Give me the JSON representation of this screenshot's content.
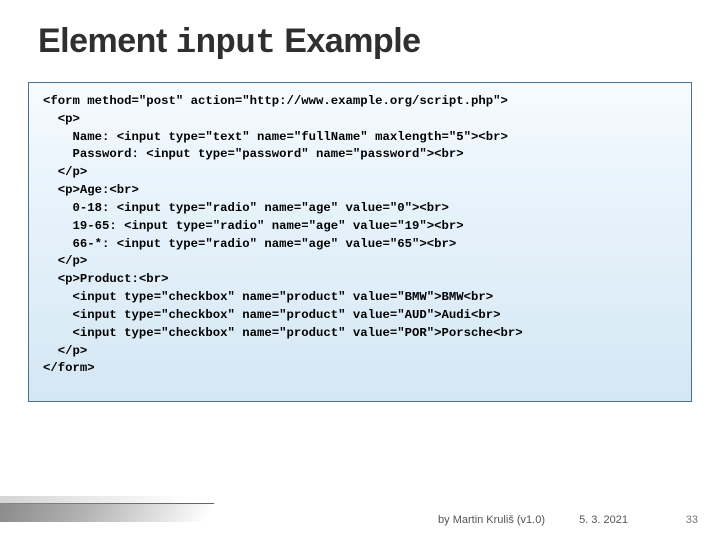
{
  "title": {
    "prefix": "Element ",
    "mono": "input",
    "suffix": " Example"
  },
  "code": {
    "l01": "<form method=\"post\" action=\"http://www.example.org/script.php\">",
    "l02": "  <p>",
    "l03": "    Name: <input type=\"text\" name=\"fullName\" maxlength=\"5\"><br>",
    "l04": "    Password: <input type=\"password\" name=\"password\"><br>",
    "l05": "  </p>",
    "l06": "  <p>Age:<br>",
    "l07": "    0-18: <input type=\"radio\" name=\"age\" value=\"0\"><br>",
    "l08": "    19-65: <input type=\"radio\" name=\"age\" value=\"19\"><br>",
    "l09": "    66-*: <input type=\"radio\" name=\"age\" value=\"65\"><br>",
    "l10": "  </p>",
    "l11": "  <p>Product:<br>",
    "l12": "    <input type=\"checkbox\" name=\"product\" value=\"BMW\">BMW<br>",
    "l13": "    <input type=\"checkbox\" name=\"product\" value=\"AUD\">Audi<br>",
    "l14": "    <input type=\"checkbox\" name=\"product\" value=\"POR\">Porsche<br>",
    "l15": "  </p>",
    "l16": "</form>"
  },
  "footer": {
    "byline": "by Martin Kruliš (v1.0)",
    "date": "5. 3. 2021",
    "page": "33"
  }
}
